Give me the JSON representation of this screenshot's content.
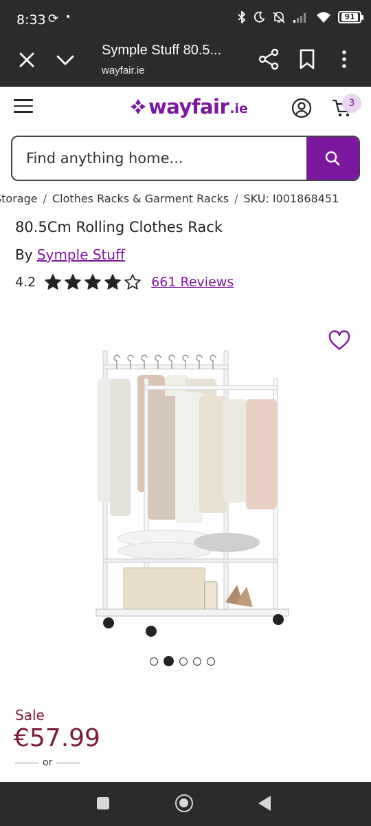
{
  "status_bar": {
    "time": "8:33",
    "battery": "91",
    "icons": [
      "sync-icon",
      "dot-icon",
      "bluetooth-icon",
      "moon-icon",
      "mute-icon",
      "signal-icon",
      "wifi-icon",
      "battery-icon"
    ]
  },
  "browser": {
    "title": "Symple Stuff 80.5...",
    "url": "wayfair.ie",
    "icons": [
      "close-icon",
      "chevron-down-icon",
      "share-icon",
      "bookmark-icon",
      "more-icon"
    ]
  },
  "header": {
    "logo_text": "wayfair",
    "logo_suffix": ".ie",
    "cart_count": "3",
    "brand_color": "#7b189f"
  },
  "search": {
    "placeholder": "Find anything home..."
  },
  "breadcrumb": {
    "items": [
      "Storage",
      "Clothes Racks & Garment Racks",
      "SKU: I001868451"
    ],
    "separator": "/"
  },
  "product": {
    "title": "80.5Cm Rolling Clothes Rack",
    "by_prefix": "By",
    "brand": "Symple Stuff",
    "rating": "4.2",
    "rating_stars": 4.2,
    "reviews_label": "661 Reviews",
    "image_alt": "White rolling clothes rack with hanging clothes, pillows, storage box and shoes"
  },
  "carousel": {
    "total": 5,
    "active_index": 1
  },
  "pricing": {
    "sale_label": "Sale",
    "price": "€57.99",
    "or_label": "or",
    "sale_color": "#7b1a3a"
  },
  "nav_bar": {
    "icons": [
      "recent-apps-icon",
      "home-icon",
      "back-icon"
    ]
  }
}
